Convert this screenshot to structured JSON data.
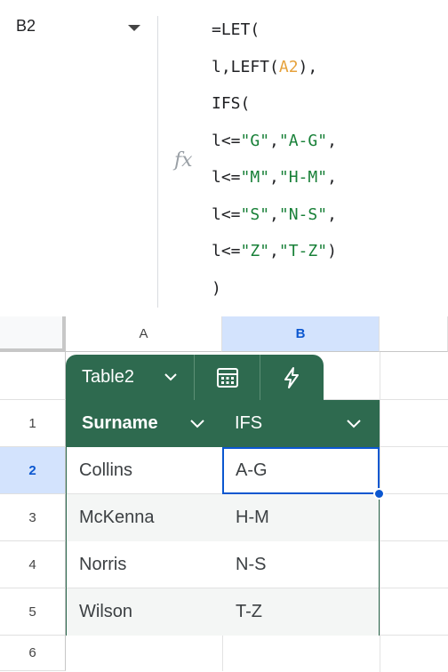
{
  "name_box": {
    "value": "B2"
  },
  "formula_bar": {
    "fx_label": "fx",
    "lines": [
      {
        "parts": [
          {
            "t": "=LET(",
            "k": "plain"
          }
        ]
      },
      {
        "parts": [
          {
            "t": "l,LEFT(",
            "k": "plain"
          },
          {
            "t": "A2",
            "k": "ref"
          },
          {
            "t": "),",
            "k": "plain"
          }
        ]
      },
      {
        "parts": [
          {
            "t": "IFS(",
            "k": "plain"
          }
        ]
      },
      {
        "parts": [
          {
            "t": "l<=",
            "k": "plain"
          },
          {
            "t": "\"G\"",
            "k": "str"
          },
          {
            "t": ",",
            "k": "plain"
          },
          {
            "t": "\"A-G\"",
            "k": "str"
          },
          {
            "t": ",",
            "k": "plain"
          }
        ]
      },
      {
        "parts": [
          {
            "t": "l<=",
            "k": "plain"
          },
          {
            "t": "\"M\"",
            "k": "str"
          },
          {
            "t": ",",
            "k": "plain"
          },
          {
            "t": "\"H-M\"",
            "k": "str"
          },
          {
            "t": ",",
            "k": "plain"
          }
        ]
      },
      {
        "parts": [
          {
            "t": "l<=",
            "k": "plain"
          },
          {
            "t": "\"S\"",
            "k": "str"
          },
          {
            "t": ",",
            "k": "plain"
          },
          {
            "t": "\"N-S\"",
            "k": "str"
          },
          {
            "t": ",",
            "k": "plain"
          }
        ]
      },
      {
        "parts": [
          {
            "t": "l<=",
            "k": "plain"
          },
          {
            "t": "\"Z\"",
            "k": "str"
          },
          {
            "t": ",",
            "k": "plain"
          },
          {
            "t": "\"T-Z\"",
            "k": "str"
          },
          {
            "t": ")",
            "k": "plain"
          }
        ]
      },
      {
        "parts": [
          {
            "t": ")",
            "k": "plain"
          }
        ]
      }
    ]
  },
  "columns": [
    "A",
    "B"
  ],
  "rows": [
    "1",
    "2",
    "3",
    "4",
    "5",
    "6"
  ],
  "selected": {
    "column": "B",
    "row": "2"
  },
  "table": {
    "name": "Table2",
    "toolbar_icons": [
      "calendar-grid-icon",
      "lightning-icon"
    ],
    "headers": [
      "Surname",
      "IFS"
    ],
    "data": [
      [
        "Collins",
        "A-G"
      ],
      [
        "McKenna",
        "H-M"
      ],
      [
        "Norris",
        "N-S"
      ],
      [
        "Wilson",
        "T-Z"
      ]
    ]
  },
  "colors": {
    "table_green": "#2e6a4f",
    "selection_blue": "#0b57d0",
    "header_highlight": "#d3e3fd",
    "string_token": "#188038",
    "ref_token": "#e6a23c"
  }
}
